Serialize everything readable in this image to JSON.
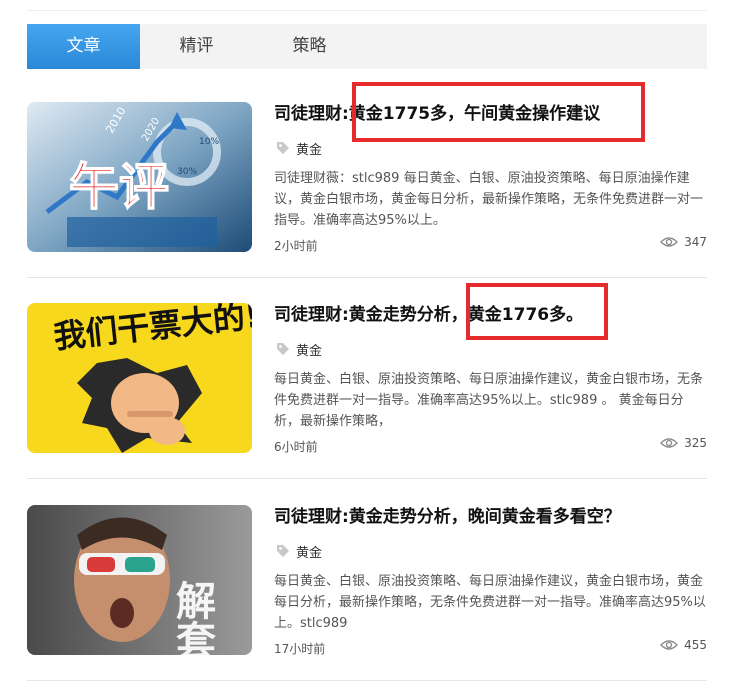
{
  "tabs": [
    {
      "label": "文章",
      "active": true
    },
    {
      "label": "精评",
      "active": false
    },
    {
      "label": "策略",
      "active": false
    }
  ],
  "articles": [
    {
      "title": "司徒理财:黄金1775多，午间黄金操作建议",
      "tag": "黄金",
      "summary": "司徒理财薇：stlc989 每日黄金、白银、原油投资策略、每日原油操作建议，黄金白银市场，黄金每日分析，最新操作策略，无条件免费进群一对一指导。准确率高达95%以上。",
      "time": "2小时前",
      "views": "347",
      "image_text": "午评",
      "image_labels": [
        "2010",
        "2020",
        "10%",
        "30%"
      ]
    },
    {
      "title": "司徒理财:黄金走势分析，黄金1776多。",
      "tag": "黄金",
      "summary": "每日黄金、白银、原油投资策略、每日原油操作建议，黄金白银市场，无条件免费进群一对一指导。准确率高达95%以上。stlc989 。 黄金每日分析，最新操作策略，",
      "time": "6小时前",
      "views": "325",
      "image_text": "我们干票大的!"
    },
    {
      "title": "司徒理财:黄金走势分析，晚间黄金看多看空？",
      "tag": "黄金",
      "summary": "每日黄金、白银、原油投资策略、每日原油操作建议，黄金白银市场，黄金每日分析，最新操作策略，无条件免费进群一对一指导。准确率高达95%以上。stlc989",
      "time": "17小时前",
      "views": "455",
      "image_text": "解套"
    }
  ],
  "colors": {
    "tab_active": "#3596e3",
    "highlight": "#e52b2b",
    "divider": "#e6e6e6"
  },
  "icons": {
    "tag": "tag-icon",
    "views": "eye-icon"
  }
}
